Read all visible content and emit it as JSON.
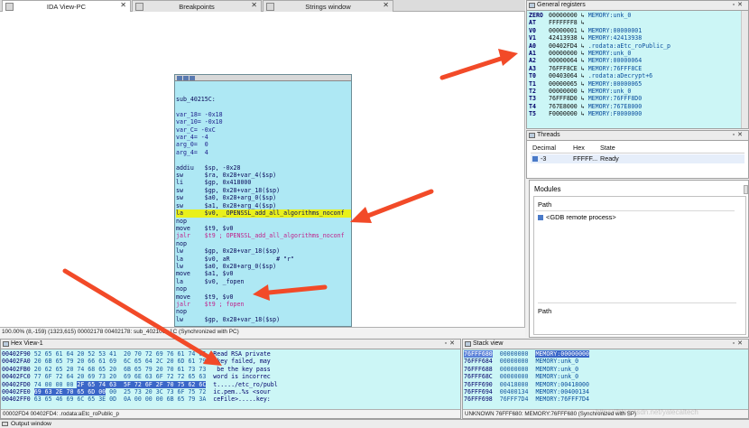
{
  "tabs": [
    {
      "label": "IDA View-PC",
      "active": true
    },
    {
      "label": "Breakpoints",
      "active": false
    },
    {
      "label": "Strings window",
      "active": false
    }
  ],
  "ida": {
    "code_lines": [
      {
        "text": "sub_40215C:",
        "cls": ""
      },
      {
        "text": "",
        "cls": ""
      },
      {
        "text": "var_18= -0x18",
        "cls": "navy"
      },
      {
        "text": "var_10= -0x10",
        "cls": "navy"
      },
      {
        "text": "var_C= -0xC",
        "cls": "navy"
      },
      {
        "text": "var_4= -4",
        "cls": "navy"
      },
      {
        "text": "arg_0=  0",
        "cls": "navy"
      },
      {
        "text": "arg_4=  4",
        "cls": "navy"
      },
      {
        "text": "",
        "cls": ""
      },
      {
        "text": "addiu   $sp, -0x28",
        "cls": ""
      },
      {
        "text": "sw      $ra, 0x28+var_4($sp)",
        "cls": ""
      },
      {
        "text": "li      $gp, 0x418000",
        "cls": ""
      },
      {
        "text": "sw      $gp, 0x28+var_18($sp)",
        "cls": ""
      },
      {
        "text": "sw      $a0, 0x28+arg_0($sp)",
        "cls": ""
      },
      {
        "text": "sw      $a1, 0x28+arg_4($sp)",
        "cls": ""
      },
      {
        "text": "la      $v0, _OPENSSL_add_all_algorithms_noconf",
        "cls": "hl"
      },
      {
        "text": "nop",
        "cls": ""
      },
      {
        "text": "move    $t9, $v0",
        "cls": ""
      },
      {
        "text": "jalr    $t9 ; OPENSSL_add_all_algorithms_noconf",
        "cls": "pink"
      },
      {
        "text": "nop",
        "cls": ""
      },
      {
        "text": "lw      $gp, 0x28+var_18($sp)",
        "cls": ""
      },
      {
        "text": "la      $v0, aR             # \"r\"",
        "cls": ""
      },
      {
        "text": "lw      $a0, 0x28+arg_0($sp)",
        "cls": ""
      },
      {
        "text": "move    $a1, $v0",
        "cls": ""
      },
      {
        "text": "la      $v0, _fopen",
        "cls": ""
      },
      {
        "text": "nop",
        "cls": ""
      },
      {
        "text": "move    $t9, $v0",
        "cls": ""
      },
      {
        "text": "jalr    $t9 ; fopen",
        "cls": "pink"
      },
      {
        "text": "nop",
        "cls": ""
      },
      {
        "text": "lw      $gp, 0x28+var_18($sp)",
        "cls": ""
      }
    ],
    "status": "100.00% (8,-159) (1323,615) 00002178 00402178: sub_40210C+1C (Synchronized with PC)"
  },
  "registers": {
    "title": "General registers",
    "rows": [
      {
        "name": "ZERO",
        "value": "00000000",
        "ann": "MEMORY:unk_0"
      },
      {
        "name": "AT",
        "value": "FFFFFFF8",
        "ann": ""
      },
      {
        "name": "V0",
        "value": "00000001",
        "ann": "MEMORY:00000001"
      },
      {
        "name": "V1",
        "value": "42413938",
        "ann": "MEMORY:42413938"
      },
      {
        "name": "A0",
        "value": "00402FD4",
        "ann": ".rodata:aEtc_roPublic_p"
      },
      {
        "name": "A1",
        "value": "00000000",
        "ann": "MEMORY:unk_0"
      },
      {
        "name": "A2",
        "value": "00000064",
        "ann": "MEMORY:00000064"
      },
      {
        "name": "A3",
        "value": "76FFF8CE",
        "ann": "MEMORY:76FFF8CE"
      },
      {
        "name": "T0",
        "value": "00403064",
        "ann": ".rodata:aDecrypt+6"
      },
      {
        "name": "T1",
        "value": "00000065",
        "ann": "MEMORY:00000065"
      },
      {
        "name": "T2",
        "value": "00000000",
        "ann": "MEMORY:unk_0"
      },
      {
        "name": "T3",
        "value": "76FFF8D0",
        "ann": "MEMORY:76FFF8D0"
      },
      {
        "name": "T4",
        "value": "767E8000",
        "ann": "MEMORY:767E8000"
      },
      {
        "name": "T5",
        "value": "F0000000",
        "ann": "MEMORY:F0000000"
      }
    ]
  },
  "threads": {
    "title": "Threads",
    "columns": [
      "Decimal",
      "Hex",
      "State"
    ],
    "rows": [
      {
        "decimal": "-3",
        "hex": "FFFFF...",
        "state": "Ready"
      }
    ]
  },
  "modules": {
    "title": "Modules",
    "column": "Path",
    "items": [
      "<GDB remote process>"
    ]
  },
  "hex": {
    "title": "Hex View-1",
    "rows": [
      {
        "addr": "00402F90",
        "pre": "52 65 61 64 20 52 53 41  20 70 72 69 76 61 74 65",
        "sel": "",
        "post": "",
        "ascii": "Read RSA private"
      },
      {
        "addr": "00402FA0",
        "pre": "20 6B 65 79 20 66 61 69  6C 65 64 2C 20 6D 61 79",
        "sel": "",
        "post": "",
        "ascii": " key failed, may"
      },
      {
        "addr": "00402FB0",
        "pre": "20 62 65 20 74 68 65 20  6B 65 79 20 70 61 73 73",
        "sel": "",
        "post": "",
        "ascii": " be the key pass"
      },
      {
        "addr": "00402FC0",
        "pre": "77 6F 72 64 20 69 73 20  69 6E 63 6F 72 72 65 63",
        "sel": "",
        "post": "",
        "ascii": "word is incorrec"
      },
      {
        "addr": "00402FD0",
        "pre": "74 00 00 00 ",
        "sel": "2F 65 74 63  5F 72 6F 2F 70 75 62 6C",
        "post": "",
        "ascii": "t...../etc_ro/publ"
      },
      {
        "addr": "00402FE0",
        "pre": "",
        "sel": "69 63 2E 70 65 6D 00",
        "post": " 00  25 73 20 3C 73 6F 75 72",
        "ascii": "ic.pem..%s <sour"
      },
      {
        "addr": "00402FF0",
        "pre": "63 65 46 69 6C 65 3E 0D  0A 00 00 00 6B 65 79 3A",
        "sel": "",
        "post": "",
        "ascii": "ceFile>.....key:"
      }
    ],
    "status": "00002FD4 00402FD4: .rodata:aEtc_roPublic_p"
  },
  "stack": {
    "title": "Stack view",
    "rows": [
      {
        "addr": "76FFF680",
        "val": "00000000",
        "ann": "MEMORY:00000000",
        "selected": true
      },
      {
        "addr": "76FFF684",
        "val": "00000000",
        "ann": "MEMORY:unk_0",
        "selected": false
      },
      {
        "addr": "76FFF688",
        "val": "00000000",
        "ann": "MEMORY:unk_0",
        "selected": false
      },
      {
        "addr": "76FFF68C",
        "val": "00000000",
        "ann": "MEMORY:unk_0",
        "selected": false
      },
      {
        "addr": "76FFF690",
        "val": "00418000",
        "ann": "MEMORY:00418000",
        "selected": false
      },
      {
        "addr": "76FFF694",
        "val": "00400134",
        "ann": "MEMORY:00400134",
        "selected": false
      },
      {
        "addr": "76FFF698",
        "val": "76FFF7D4",
        "ann": "MEMORY:76FFF7D4",
        "selected": false
      }
    ],
    "status": "UNKNOWN 76FFF680: MEMORY:76FFF680 (Synchronized with SP)"
  },
  "output": {
    "title": "Output window"
  },
  "watermark": "https://blog.csdn.net/yalecaltech",
  "colors": {
    "arrow": "#f24a28",
    "highlight": "#e9f01a",
    "panel_bg": "#ccf6f6",
    "node_bg": "#aee8f4"
  }
}
